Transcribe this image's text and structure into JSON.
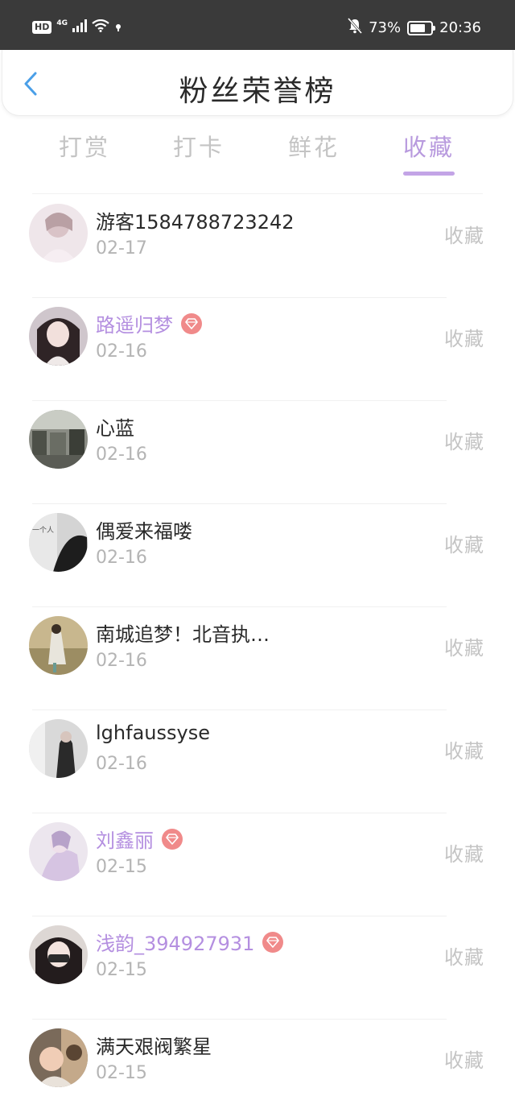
{
  "status_bar": {
    "hd": "HD",
    "network": "4G",
    "battery_percent_text": "73%",
    "battery_level": 0.73,
    "time": "20:36"
  },
  "header": {
    "back_icon": "chevron-left-icon",
    "title": "粉丝荣誉榜"
  },
  "tabs": [
    {
      "label": "打赏",
      "active": false
    },
    {
      "label": "打卡",
      "active": false
    },
    {
      "label": "鲜花",
      "active": false
    },
    {
      "label": "收藏",
      "active": true
    }
  ],
  "colors": {
    "accent": "#b89ade",
    "vip_name": "#b48fe0",
    "vip_badge": "#f08a8a",
    "muted": "#c4c4c4"
  },
  "fans": [
    {
      "name": "游客1584788723242",
      "date": "02-17",
      "action": "收藏",
      "vip": false
    },
    {
      "name": "路遥归梦",
      "date": "02-16",
      "action": "收藏",
      "vip": true
    },
    {
      "name": "心蓝",
      "date": "02-16",
      "action": "收藏",
      "vip": false
    },
    {
      "name": "偶爱来福喽",
      "date": "02-16",
      "action": "收藏",
      "vip": false
    },
    {
      "name": "南城追梦！北音执…",
      "date": "02-16",
      "action": "收藏",
      "vip": false
    },
    {
      "name": "lghfaussyse",
      "date": "02-16",
      "action": "收藏",
      "vip": false
    },
    {
      "name": "刘鑫丽",
      "date": "02-15",
      "action": "收藏",
      "vip": true
    },
    {
      "name": "浅韵_394927931",
      "date": "02-15",
      "action": "收藏",
      "vip": true
    },
    {
      "name": "满天艰阀繁星",
      "date": "02-15",
      "action": "收藏",
      "vip": false
    }
  ]
}
